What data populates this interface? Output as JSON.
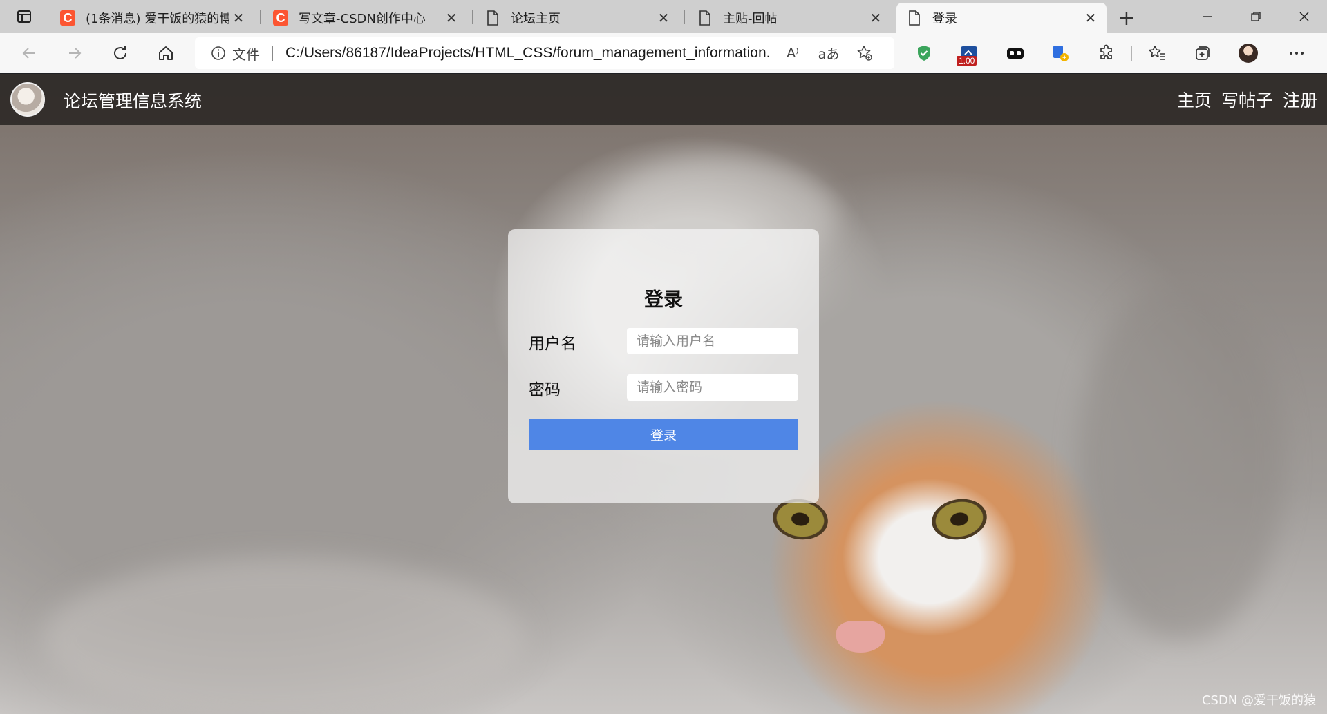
{
  "browser": {
    "tabs": [
      {
        "title": "(1条消息) 爱干饭的猿的博",
        "icon": "csdn-icon"
      },
      {
        "title": "写文章-CSDN创作中心",
        "icon": "csdn-icon"
      },
      {
        "title": "论坛主页",
        "icon": "page-icon"
      },
      {
        "title": "主贴-回帖",
        "icon": "page-icon"
      },
      {
        "title": "登录",
        "icon": "page-icon",
        "active": true
      }
    ],
    "address": {
      "file_label": "文件",
      "url": "C:/Users/86187/IdeaProjects/HTML_CSS/forum_management_information..."
    },
    "read_aloud_label": "A⁾",
    "translate_label": "aあ",
    "extension_badge": "1.00"
  },
  "site": {
    "title": "论坛管理信息系统",
    "nav": [
      "主页",
      "写帖子",
      "注册"
    ]
  },
  "login": {
    "heading": "登录",
    "username_label": "用户名",
    "username_placeholder": "请输入用户名",
    "password_label": "密码",
    "password_placeholder": "请输入密码",
    "submit_label": "登录"
  },
  "watermark": "CSDN @爱干饭的猿",
  "colors": {
    "accent": "#4f86e6",
    "csdn_brand": "#fc5531",
    "header_bg": "#282422"
  }
}
